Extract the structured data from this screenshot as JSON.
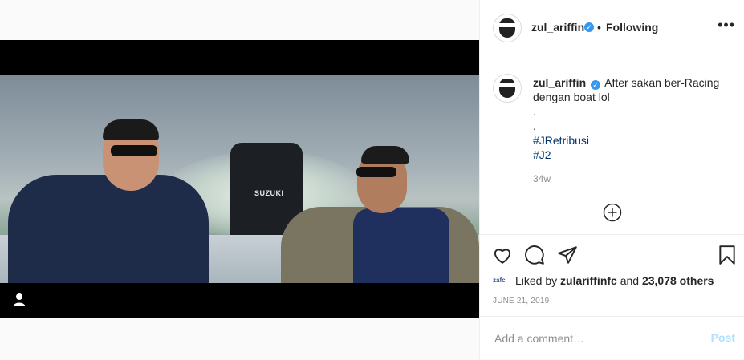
{
  "post": {
    "username": "zul_ariffin",
    "separator": "•",
    "follow_status": "Following",
    "more_icon": "more-dots-icon"
  },
  "caption": {
    "username": "zul_ariffin",
    "text_line1": "After sakan ber-Racing",
    "text_line2": "dengan boat lol",
    "dot1": ".",
    "dot2": ".",
    "hashtag1": "#JRetribusi",
    "hashtag2": "#J2",
    "age": "34w"
  },
  "media": {
    "motor_brand": "SUZUKI"
  },
  "engagement": {
    "liker_avatar": "zafc",
    "liked_by_prefix": "Liked by",
    "liked_by_user": "zulariffinfc",
    "liked_by_and": "and",
    "liked_by_count": "23,078 others",
    "date": "JUNE 21, 2019"
  },
  "comment": {
    "placeholder": "Add a comment…",
    "post_label": "Post"
  },
  "colors": {
    "accent": "#3897f0",
    "link": "#00376b",
    "muted": "#8e8e8e",
    "post_disabled": "#b2dffc"
  }
}
